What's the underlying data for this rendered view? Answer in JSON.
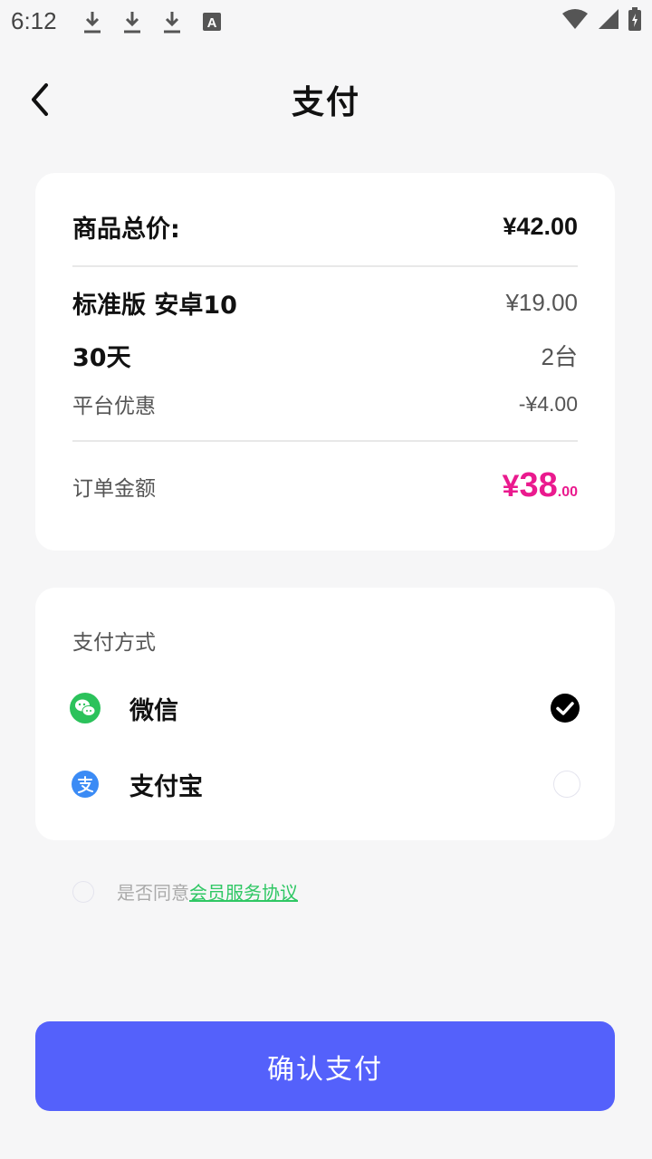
{
  "status_bar": {
    "time": "6:12",
    "icons": [
      "download-icon",
      "download-icon",
      "download-icon",
      "a-icon",
      "wifi-icon",
      "signal-icon",
      "battery-icon"
    ]
  },
  "header": {
    "title": "支付",
    "back_icon": "back-arrow-icon"
  },
  "summary": {
    "total_label": "商品总价:",
    "total_value": "¥42.00",
    "product_name": "标准版 安卓10",
    "product_price": "¥19.00",
    "duration": "30天",
    "device_count": "2台",
    "discount_label": "平台优惠",
    "discount_value": "-¥4.00",
    "order_label": "订单金额",
    "order_amount": {
      "symbol": "¥",
      "integer": "38",
      "decimal": ".00"
    }
  },
  "payment": {
    "section_label": "支付方式",
    "methods": [
      {
        "label": "微信",
        "icon": "wechat-icon",
        "selected": true
      },
      {
        "label": "支付宝",
        "icon": "alipay-icon",
        "selected": false
      }
    ]
  },
  "agreement": {
    "prefix": "是否同意",
    "link": "会员服务协议",
    "checked": false
  },
  "confirm_label": "确认支付",
  "colors": {
    "accent": "#5461fb",
    "price": "#ea1a8e",
    "link": "#2fc764",
    "wechat": "#2bc25b",
    "alipay": "#3b8bf5"
  }
}
